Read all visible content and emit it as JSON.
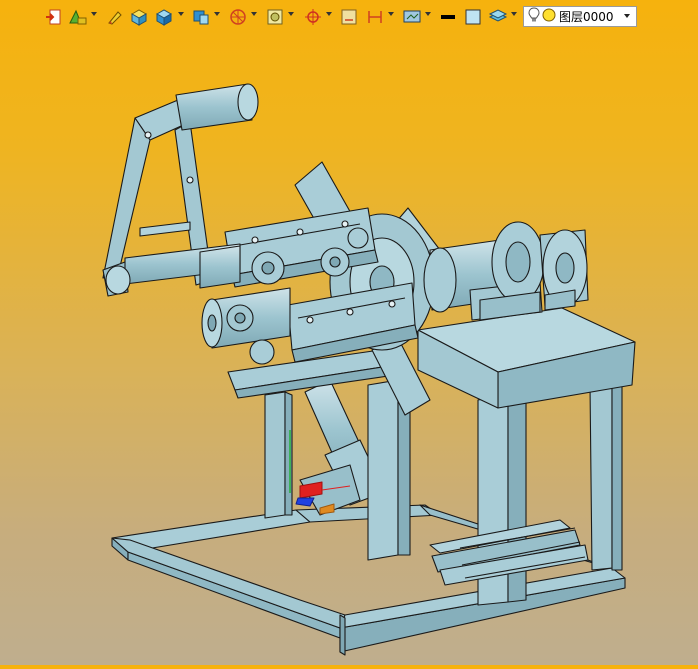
{
  "toolbar": {
    "icons": [
      "import-icon",
      "sketch-tools-icon",
      "pencil-icon",
      "solid-box-icon",
      "cube-icon",
      "view-orientation-icon",
      "circle-snap-icon",
      "render-mode-icon",
      "crosshair-icon",
      "dimension-icon",
      "measure-icon",
      "display-settings-icon",
      "line-color-icon",
      "fill-color-icon",
      "layer-manager-icon"
    ],
    "colors": {
      "line": "#000000",
      "fill": "#bfe3f2"
    }
  },
  "layer": {
    "name": "图层0000",
    "visible_icon": "lightbulb-icon",
    "state_icon": "yellow-circle-icon"
  },
  "viewport": {
    "background_top": "#f6b20d",
    "background_bottom": "#bfae8e",
    "model_color": "#9cc4cf",
    "model_edge_color": "#1a1a1a",
    "axis_colors": {
      "x": "#e02020",
      "y": "#20b030",
      "z": "#2040e0"
    }
  }
}
